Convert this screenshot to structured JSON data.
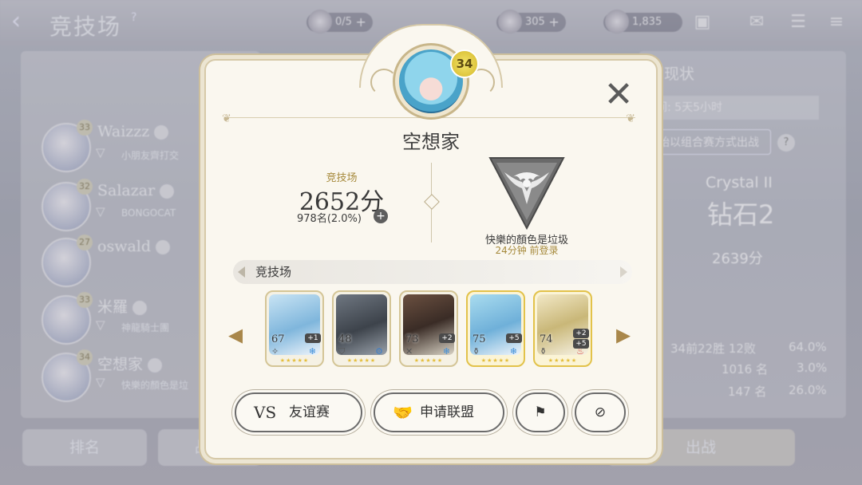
{
  "background": {
    "title": "竞技场",
    "help": "?",
    "resources": [
      {
        "value": "0/5",
        "has_plus": true
      },
      {
        "value": "305",
        "has_plus": true
      },
      {
        "value": "1,835",
        "has_plus": false
      }
    ],
    "rank_list": [
      {
        "name": "Waizzz",
        "level": "33",
        "guild": "小朋友齊打交"
      },
      {
        "name": "Salazar",
        "level": "32",
        "guild": "BONGOCAT"
      },
      {
        "name": "oswald",
        "level": "27",
        "guild": ""
      },
      {
        "name": "米羅",
        "level": "33",
        "guild": "神龍騎士團"
      },
      {
        "name": "空想家",
        "level": "34",
        "guild": "快樂的顏色是垃"
      }
    ],
    "right_panel": {
      "title": "现状",
      "time_left": "间: 5天5小时",
      "combo_button": "始以组合赛方式出战",
      "tier_en": "Crystal II",
      "tier_zh": "钻石2",
      "score": "2639分",
      "stats": [
        {
          "a": "34前",
          "b": "22胜 12败",
          "c": "64.0%"
        },
        {
          "a": "",
          "b": "1016 名",
          "c": "3.0%"
        },
        {
          "a": "",
          "b": "147 名",
          "c": "26.0%"
        }
      ]
    },
    "bottom_tabs": {
      "ranking": "排名",
      "record": "战斗",
      "battle": "出战"
    }
  },
  "modal": {
    "player_level": "34",
    "player_name": "空想家",
    "arena_label": "竞技场",
    "arena_score": "2652分",
    "arena_rank": "978名(2.0%)",
    "guild_name": "快樂的顏色是垃圾",
    "last_login": "24分钟 前登录",
    "section_title": "竞技场",
    "close_icon": "close-icon",
    "heroes": [
      {
        "level": "67",
        "bonus": "+1",
        "class_icon": "✧",
        "element_icon": "❄",
        "element_color": "#3d8ed8",
        "border": "silver",
        "art": "linear-gradient(160deg,#c9e4f4,#7fb6dc 55%,#eef4fb)"
      },
      {
        "level": "48",
        "bonus": "",
        "class_icon": "⛉",
        "element_icon": "⚙",
        "element_color": "#3d7fc8",
        "border": "silver",
        "art": "linear-gradient(160deg,#6f7781,#3d434b 55%,#9aa2ab)"
      },
      {
        "level": "73",
        "bonus": "+2",
        "class_icon": "✕",
        "element_icon": "❄",
        "element_color": "#3d8ed8",
        "border": "silver",
        "art": "linear-gradient(160deg,#6b5040,#3a2c26 50%,#d8d2c4)"
      },
      {
        "level": "75",
        "bonus": "+5",
        "class_icon": "⚱",
        "element_icon": "❄",
        "element_color": "#3d8ed8",
        "border": "gold",
        "art": "linear-gradient(160deg,#a9dcef,#6fb0d9 55%,#f0f5fb)"
      },
      {
        "level": "74",
        "bonus": "+2 +5",
        "class_icon": "⚱",
        "element_icon": "♨",
        "element_color": "#d8453d",
        "border": "gold",
        "art": "linear-gradient(160deg,#f2e8c6,#c9b778 50%,#f7f3e6)"
      }
    ],
    "buttons": {
      "friendly_icon": "VS",
      "friendly_label": "友谊赛",
      "alliance_label": "申请联盟"
    }
  }
}
